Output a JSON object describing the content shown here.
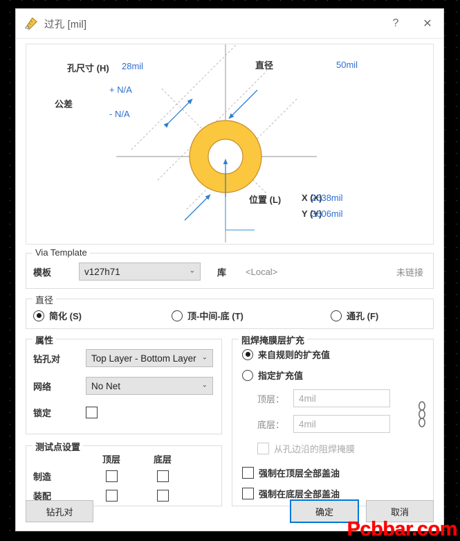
{
  "window": {
    "title": "过孔 [mil]",
    "icon": "via-ruler-icon",
    "help_label": "?",
    "close_label": "✕"
  },
  "preview": {
    "hole_size_label": "孔尺寸 (H)",
    "hole_size_hotkey": "H",
    "hole_size_value": "28mil",
    "tolerance_label": "公差",
    "tolerance_plus": "+ N/A",
    "tolerance_minus": "- N/A",
    "diameter_label": "直径",
    "diameter_value": "50mil",
    "location_label": "位置 (L)",
    "location_hotkey": "L",
    "x_label": "X (X)",
    "x_value": "2538mil",
    "y_label": "Y (Y)",
    "y_value": "3606mil",
    "pad_color": "#FBC73F",
    "pad_edge_color": "#c98a24",
    "axis_color": "#9a9a9a",
    "dim_color": "#2f7fd0"
  },
  "via_template": {
    "group_title": "Via Template",
    "template_label": "模板",
    "template_value": "v127h71",
    "library_label": "库",
    "library_value": "<Local>",
    "link_status": "未链接"
  },
  "diameter_group": {
    "group_title": "直径",
    "options": [
      {
        "label": "简化 (S)",
        "hotkey": "S",
        "selected": true
      },
      {
        "label": "顶-中间-底 (T)",
        "hotkey": "T",
        "selected": false
      },
      {
        "label": "通孔 (F)",
        "hotkey": "F",
        "selected": false
      }
    ]
  },
  "properties": {
    "group_title": "属性",
    "drill_pair_label": "钻孔对",
    "drill_pair_value": "Top Layer - Bottom Layer",
    "net_label": "网络",
    "net_value": "No Net",
    "lock_label": "锁定",
    "lock_checked": false
  },
  "testpoint": {
    "group_title": "测试点设置",
    "col_top": "顶层",
    "col_bottom": "底层",
    "rows": [
      {
        "label": "制造",
        "top_checked": false,
        "bottom_checked": false
      },
      {
        "label": "装配",
        "top_checked": false,
        "bottom_checked": false
      }
    ]
  },
  "soldermask": {
    "group_title": "阻焊掩膜层扩充",
    "rule_option": "来自规则的扩充值",
    "rule_selected": true,
    "manual_option": "指定扩充值",
    "manual_selected": false,
    "top_label": "顶层：",
    "top_value": "4mil",
    "bottom_label": "底层：",
    "bottom_value": "4mil",
    "link_icon": "chain-link-icon",
    "from_hole_edge_label": "从孔边沿的阻焊掩膜",
    "from_hole_edge_checked": false,
    "force_top_label": "强制在顶层全部盖油",
    "force_top_checked": false,
    "force_bottom_label": "强制在底层全部盖油",
    "force_bottom_checked": false
  },
  "footer": {
    "drill_pair_button": "钻孔对",
    "ok_button": "确定",
    "cancel_button": "取消"
  },
  "watermark": {
    "text": "Pcbbar.com",
    "color": "#ff0000"
  }
}
